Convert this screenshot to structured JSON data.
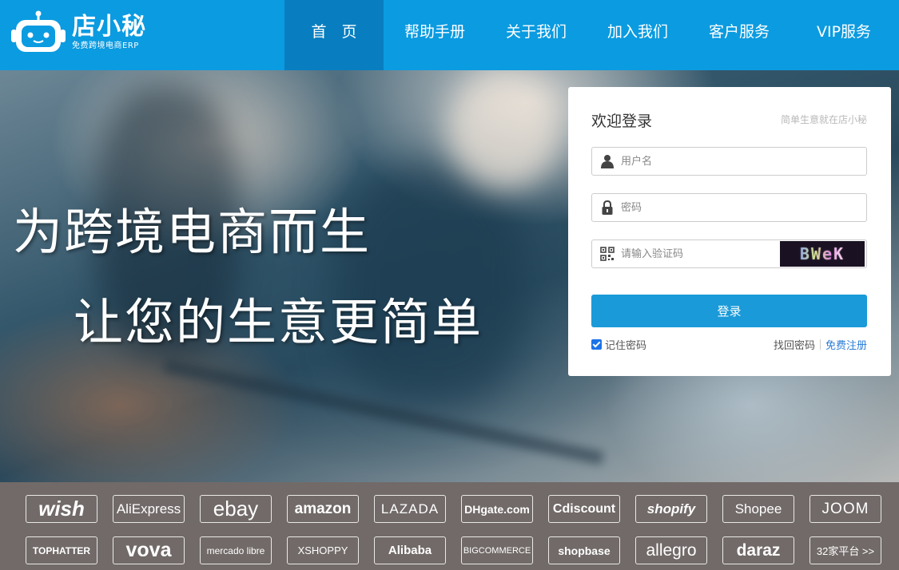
{
  "header": {
    "logo_name": "店小秘",
    "logo_slogan": "免费跨境电商ERP",
    "nav": [
      {
        "label": "首　页",
        "active": true
      },
      {
        "label": "帮助手册",
        "active": false
      },
      {
        "label": "关于我们",
        "active": false
      },
      {
        "label": "加入我们",
        "active": false
      },
      {
        "label": "客户服务",
        "active": false
      },
      {
        "label": "VIP服务",
        "active": false
      }
    ],
    "colors": {
      "bar": "#0b9be0",
      "active": "#087ec0"
    }
  },
  "hero": {
    "slogan_line1": "为跨境电商而生",
    "slogan_line2": "让您的生意更简单"
  },
  "login": {
    "title": "欢迎登录",
    "subtitle": "简单生意就在店小秘",
    "username_placeholder": "用户名",
    "password_placeholder": "密码",
    "captcha_placeholder": "请输入验证码",
    "captcha_text": "BWeK",
    "submit_label": "登录",
    "remember_label": "记住密码",
    "remember_checked": true,
    "forgot_label": "找回密码",
    "register_label": "免费注册",
    "colors": {
      "button": "#1a9ad8",
      "link": "#2a7bd6"
    }
  },
  "platforms": {
    "row1": [
      "wish",
      "AliExpress",
      "ebay",
      "amazon",
      "LAZADA",
      "DHgate.com",
      "Cdiscount",
      "shopify",
      "Shopee",
      "JOOM"
    ],
    "row2": [
      "TOPHATTER",
      "vova",
      "mercado libre",
      "XSHOPPY",
      "Alibaba",
      "BIGCOMMERCE",
      "shopbase",
      "allegro",
      "daraz",
      "32家平台 >>"
    ]
  }
}
